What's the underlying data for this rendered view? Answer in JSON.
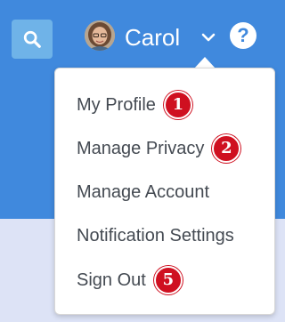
{
  "header": {
    "search_icon": "search-icon",
    "user_name": "Carol",
    "dropdown_icon": "chevron-down-icon",
    "help_label": "?"
  },
  "menu": {
    "items": [
      {
        "label": "My Profile",
        "badge": "1"
      },
      {
        "label": "Manage Privacy",
        "badge": "2"
      },
      {
        "label": "Manage Account"
      },
      {
        "label": "Notification Settings"
      },
      {
        "label": "Sign Out",
        "badge": "5"
      }
    ]
  },
  "colors": {
    "header_bg": "#4089dd",
    "search_bg": "#6fb3e8",
    "page_bg": "#dde3f6",
    "badge_red": "#cf1020",
    "menu_text": "#444a52"
  }
}
